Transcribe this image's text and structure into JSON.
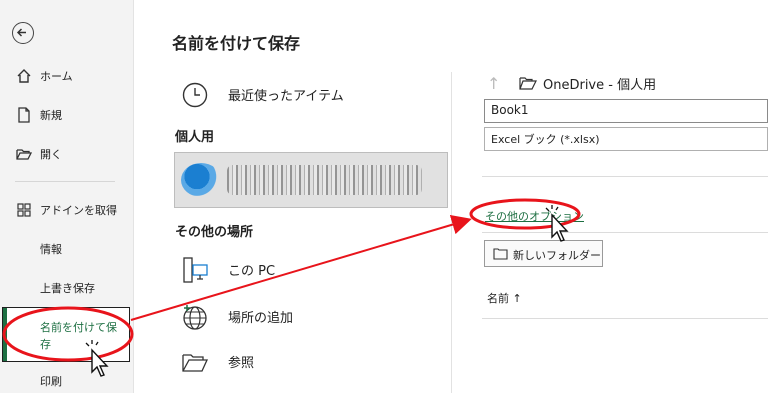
{
  "sidebar": {
    "items": [
      {
        "label": "ホーム",
        "icon": "home-icon"
      },
      {
        "label": "新規",
        "icon": "new-document-icon"
      },
      {
        "label": "開く",
        "icon": "open-folder-icon"
      },
      {
        "label": "アドインを取得",
        "icon": "addins-grid-icon"
      },
      {
        "label": "情報"
      },
      {
        "label": "上書き保存"
      },
      {
        "label": "名前を付けて保存"
      },
      {
        "label": "印刷"
      }
    ]
  },
  "main": {
    "title": "名前を付けて保存",
    "recent_label": "最近使ったアイテム",
    "personal_header": "個人用",
    "other_header": "その他の場所",
    "locations": [
      {
        "label": "この PC",
        "icon": "this-pc-icon"
      },
      {
        "label": "場所の追加",
        "icon": "globe-icon"
      },
      {
        "label": "参照",
        "icon": "browse-folder-icon"
      }
    ]
  },
  "right": {
    "breadcrumb": "OneDrive - 個人用",
    "filename_value": "Book1",
    "filetype_value": "Excel ブック (*.xlsx)",
    "options_link": "その他のオプション",
    "new_folder_label": "新しいフォルダー",
    "sort_header": "名前 ↑"
  },
  "colors": {
    "accent_green": "#1d6f42",
    "annotation_red": "#e8141b"
  }
}
